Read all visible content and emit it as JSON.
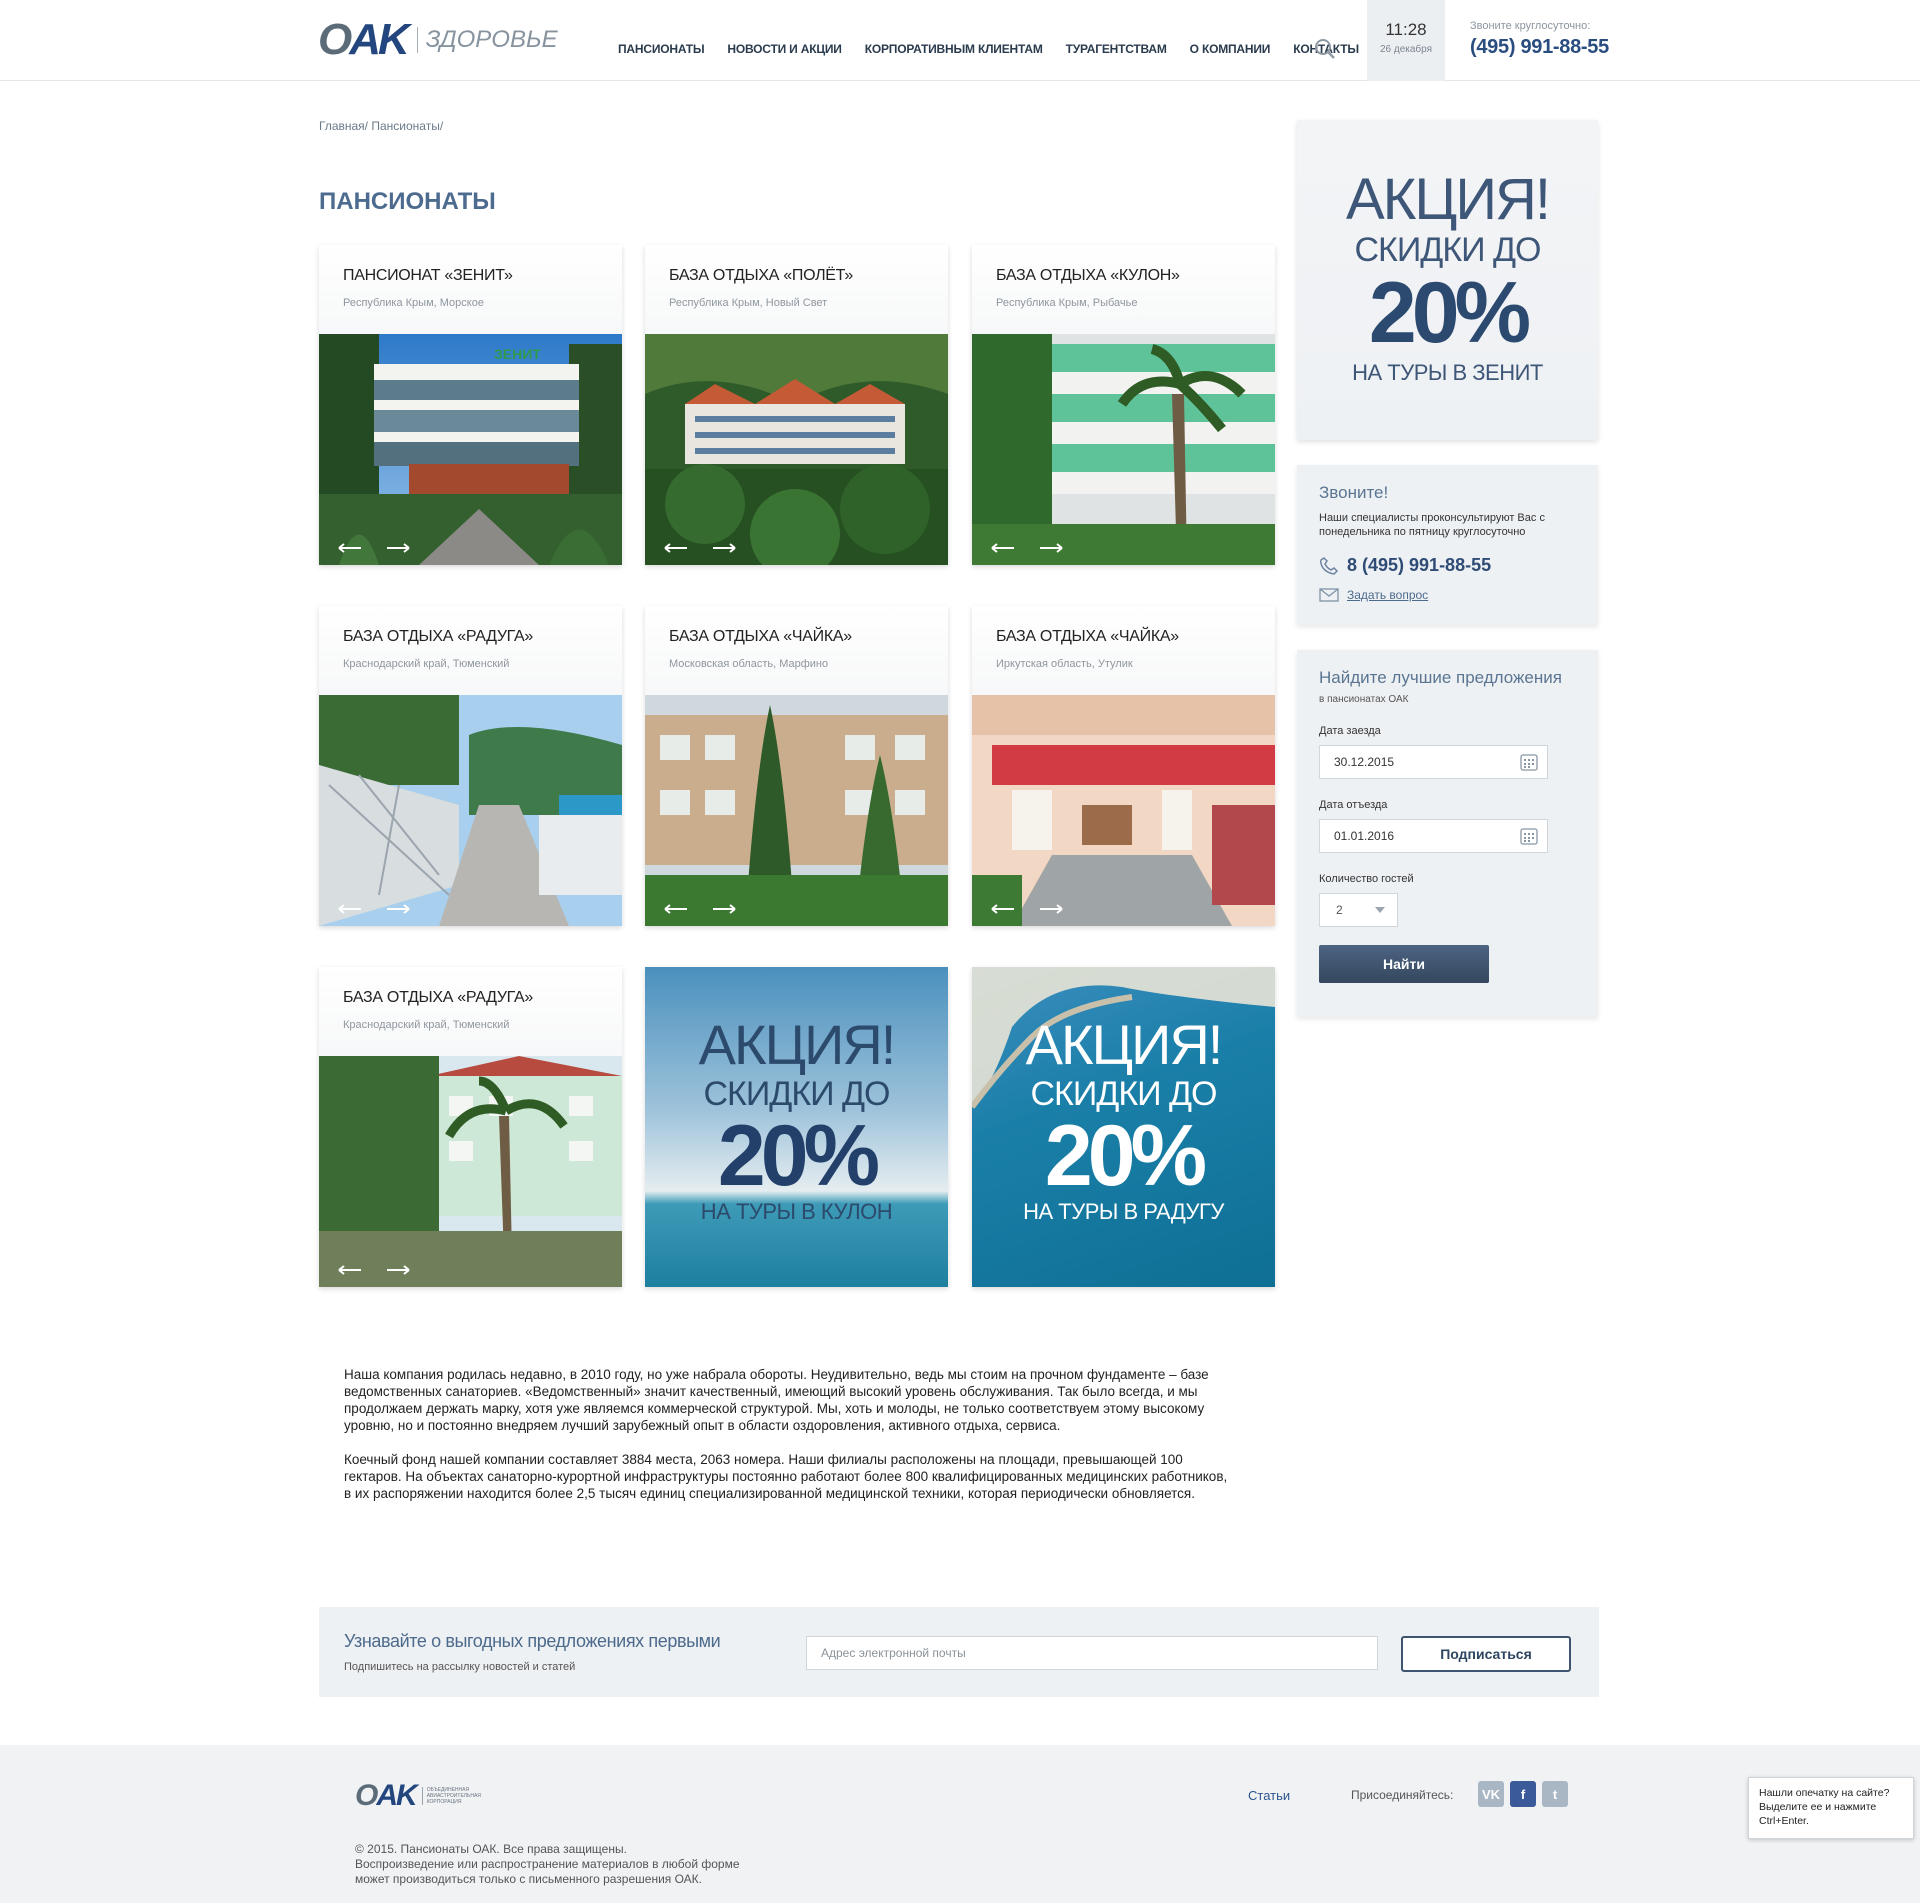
{
  "header": {
    "logo_main": "OAK",
    "logo_sub": "ЗДОРОВЬЕ",
    "nav": [
      "ПАНСИОНАТЫ",
      "НОВОСТИ И АКЦИИ",
      "КОРПОРАТИВНЫМ КЛИЕНТАМ",
      "ТУРАГЕНТСТВАМ",
      "О КОМПАНИИ",
      "КОНТАКТЫ"
    ],
    "time": "11:28",
    "date": "26 декабря",
    "phone_caption": "Звоните круглосуточно:",
    "phone": "(495) 991-88-55"
  },
  "breadcrumb": [
    "Главная/",
    "Пансионаты/"
  ],
  "page_title": "ПАНСИОНАТЫ",
  "cards": [
    {
      "title": "ПАНСИОНАТ «ЗЕНИТ»",
      "location": "Республика Крым, Морское",
      "sign": "ЗЕНИТ"
    },
    {
      "title": "БАЗА ОТДЫХА «ПОЛЁТ»",
      "location": "Республика Крым, Новый Свет"
    },
    {
      "title": "БАЗА ОТДЫХА «КУЛОН»",
      "location": "Республика Крым, Рыбачье"
    },
    {
      "title": "БАЗА ОТДЫХА «РАДУГА»",
      "location": "Краснодарский край, Тюменский"
    },
    {
      "title": "БАЗА ОТДЫХА «ЧАЙКА»",
      "location": "Московская область, Марфино"
    },
    {
      "title": "БАЗА ОТДЫХА «ЧАЙКА»",
      "location": "Иркутская область, Утулик"
    },
    {
      "title": "БАЗА ОТДЫХА «РАДУГА»",
      "location": "Краснодарский край, Тюменский"
    }
  ],
  "promos": [
    {
      "a": "АКЦИЯ!",
      "b": "СКИДКИ ДО",
      "c": "20%",
      "d": "НА ТУРЫ В КУЛОН"
    },
    {
      "a": "АКЦИЯ!",
      "b": "СКИДКИ ДО",
      "c": "20%",
      "d": "НА ТУРЫ В РАДУГУ"
    }
  ],
  "sidebar": {
    "promo": {
      "a": "АКЦИЯ!",
      "b": "СКИДКИ ДО",
      "c": "20%",
      "d": "НА ТУРЫ В ЗЕНИТ"
    },
    "call": {
      "heading": "Звоните!",
      "text": "Наши специалисты проконсультируют Вас с понедельника по пятницу круглосуточно",
      "phone": "8 (495) 991-88-55",
      "ask": "Задать вопрос"
    },
    "form": {
      "heading": "Найдите лучшие предложения",
      "sub": "в пансионатах ОАК",
      "checkin_label": "Дата заезда",
      "checkin_value": "30.12.2015",
      "checkout_label": "Дата отъезда",
      "checkout_value": "01.01.2016",
      "guests_label": "Количество гостей",
      "guests_value": "2",
      "submit": "Найти"
    }
  },
  "about": [
    "Наша компания родилась недавно, в 2010 году, но уже набрала обороты. Неудивительно, ведь мы стоим на прочном фундаменте – базе ведомственных санаториев. «Ведомственный» значит качественный, имеющий высокий уровень обслуживания. Так было всегда, и мы продолжаем держать марку, хотя уже являемся коммерческой структурой. Мы, хоть и молоды, не только соответствуем этому высокому уровню, но и постоянно внедряем лучший зарубежный опыт в области оздоровления, активного отдыха, сервиса.",
    "Коечный фонд нашей компании составляет 3884 места, 2063 номера. Наши филиалы расположены на площади, превышающей 100 гектаров. На объектах санаторно-курортной инфраструктуры  постоянно работают более 800 квалифицированных медицинских работников, в их распоряжении находится более 2,5 тысяч единиц специализированной медицинской техники, которая периодически обновляется."
  ],
  "subscribe": {
    "heading": "Узнавайте о выгодных предложениях первыми",
    "sub": "Подпишитесь на рассылку новостей и статей",
    "placeholder": "Адрес электронной почты",
    "button": "Подписаться"
  },
  "footer": {
    "logo_main": "OAK",
    "logo_text": "ОБЪЕДИНЕННАЯ АВИАСТРОИТЕЛЬНАЯ КОРПОРАЦИЯ",
    "copy": [
      "© 2015. Пансионаты ОАК. Все права защищены.",
      "Воспроизведение или распространение материалов в любой форме",
      "может производиться только с письменного разрешения ОАК."
    ],
    "articles": "Статьи",
    "join": "Присоединяйтесь:",
    "social_vk": "VK",
    "social_fb": "f",
    "social_tw": "t"
  },
  "typo_notice": [
    "Нашли опечатку на сайте?",
    "Выделите ее и нажмите",
    "Ctrl+Enter."
  ],
  "colors": {
    "brand_blue": "#22467d",
    "accent_text": "#4c6b8e",
    "panel": "#eef1f4"
  }
}
